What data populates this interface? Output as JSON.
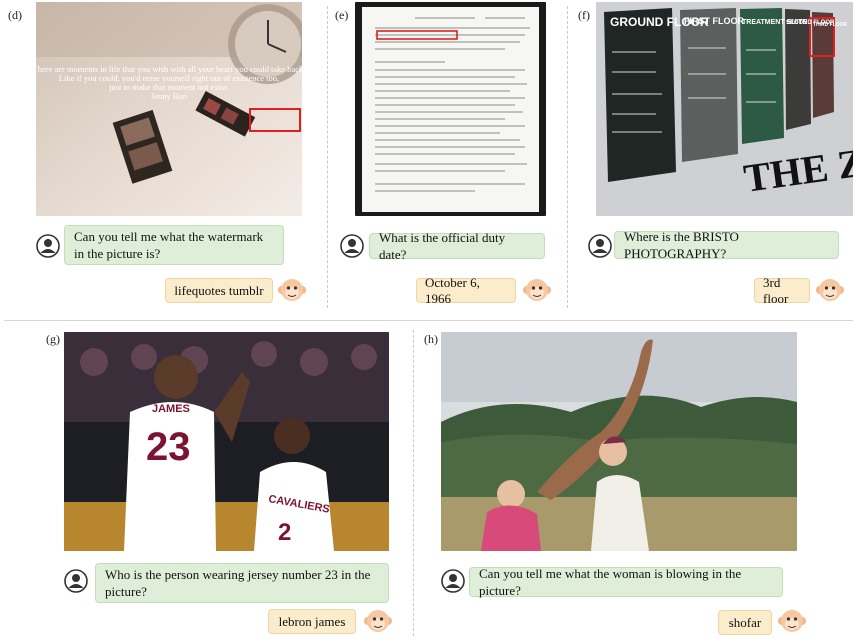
{
  "panels": [
    {
      "label": "(d)",
      "image": "photo of clock and film strips with quote text",
      "overlay_lines": [
        "There are moments in life that you wish with all your heart you could take back.",
        "Like if you could, you'd erase yourself right out of existence too,",
        "just to make that moment not exist.",
        "Jenny Han"
      ],
      "question": "Can you tell me what the watermark in the picture is?",
      "answer": "lifequotes tumblr"
    },
    {
      "label": "(e)",
      "image": "scanned typewritten government document",
      "question": "What is the official duty date?",
      "answer": "October 6, 1966"
    },
    {
      "label": "(f)",
      "image": "wall floor directory signs",
      "signs": [
        "GROUND FLOOR",
        "FIRST FLOOR",
        "TREATMENT SUITE",
        "SECOND FLOOR",
        "THIRD FLOOR"
      ],
      "wall_text": "THE ZONE",
      "question": "Where is the BRISTO PHOTOGRAPHY?",
      "answer": "3rd floor"
    },
    {
      "label": "(g)",
      "image": "two basketball players talking on court",
      "jersey_name": "JAMES",
      "jersey_number": "23",
      "jersey2_text": "CAVALIERS",
      "jersey2_number": "2",
      "question": "Who is the person wearing jersey number 23 in the picture?",
      "answer": "lebron james"
    },
    {
      "label": "(h)",
      "image": "woman blowing a horn outdoors in mountains",
      "question": "Can you tell me what the woman is blowing in the picture?",
      "answer": "shofar"
    }
  ],
  "colors": {
    "question_bg": "#dfeed8",
    "answer_bg": "#fbeccb"
  },
  "icons": {
    "user": "user-avatar-icon",
    "bot": "monkey-bot-icon"
  }
}
